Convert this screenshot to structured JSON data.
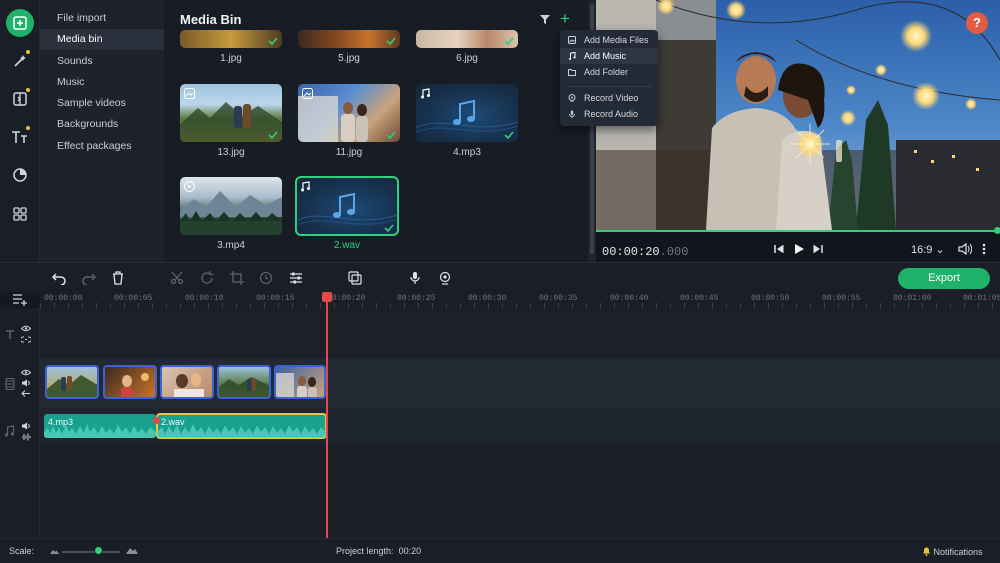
{
  "sidebar": {
    "categories": [
      "File import",
      "Media bin",
      "Sounds",
      "Music",
      "Sample videos",
      "Backgrounds",
      "Effect packages"
    ],
    "active_index": 1
  },
  "media_bin": {
    "title": "Media Bin",
    "items": [
      {
        "name": "1.jpg"
      },
      {
        "name": "5.jpg"
      },
      {
        "name": "6.jpg"
      },
      {
        "name": "13.jpg"
      },
      {
        "name": "11.jpg"
      },
      {
        "name": "4.mp3"
      },
      {
        "name": "3.mp4"
      },
      {
        "name": "2.wav"
      }
    ],
    "selected": "2.wav"
  },
  "add_menu": {
    "items": [
      "Add Media Files",
      "Add Music",
      "Add Folder",
      "Record Video",
      "Record Audio"
    ],
    "highlighted": "Add Music"
  },
  "preview": {
    "help": "?",
    "time_main": "00:00:20",
    "time_ms": ".000",
    "aspect_ratio": "16:9",
    "progress_fraction": 1.0
  },
  "toolbar": {
    "export_label": "Export"
  },
  "ruler": {
    "ticks": [
      "00:00:00",
      "00:00:05",
      "00:00:10",
      "00:00:15",
      "00:00:20",
      "00:00:25",
      "00:00:30",
      "00:00:35",
      "00:00:40",
      "00:00:45",
      "00:00:50",
      "00:00:55",
      "00:01:00",
      "00:01:05"
    ]
  },
  "audio_clips": [
    {
      "name": "4.mp3"
    },
    {
      "name": "2.wav"
    }
  ],
  "status": {
    "scale_label": "Scale:",
    "project_length_label": "Project length:",
    "project_length_value": "00:20",
    "notifications_label": "Notifications"
  },
  "colors": {
    "accent": "#1fb26a",
    "accent_light": "#2fcf7d",
    "playhead": "#e24a4a",
    "clip_border": "#3b63d8",
    "audio_clip": "#1aa08f",
    "selected_clip": "#e9c547",
    "help_button": "#e25b43"
  }
}
